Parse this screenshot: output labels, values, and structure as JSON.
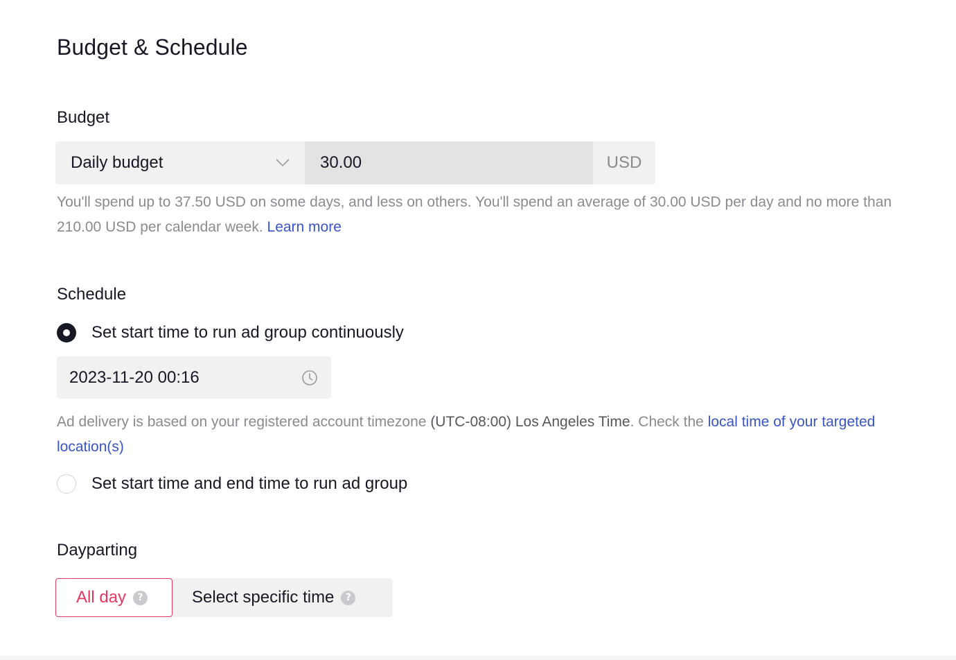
{
  "page": {
    "title": "Budget & Schedule"
  },
  "budget": {
    "section_title": "Budget",
    "type_selected": "Daily budget",
    "amount": "30.00",
    "currency": "USD",
    "help_text": "You'll spend up to 37.50 USD on some days, and less on others. You'll spend an average of 30.00 USD per day and no more than 210.00 USD per calendar week.",
    "learn_more": "Learn more"
  },
  "schedule": {
    "section_title": "Schedule",
    "option_continuous": "Set start time to run ad group continuously",
    "start_datetime": "2023-11-20 00:16",
    "timezone_prefix": "Ad delivery is based on your registered account timezone",
    "timezone_value": "(UTC-08:00) Los Angeles Time",
    "timezone_suffix": ". Check the",
    "local_time_link": "local time of your targeted location(s)",
    "option_start_end": "Set start time and end time to run ad group",
    "selected_option": "continuous"
  },
  "dayparting": {
    "section_title": "Dayparting",
    "option_all_day": "All day",
    "option_specific": "Select specific time",
    "selected": "All day"
  },
  "colors": {
    "accent": "#e3385f",
    "link": "#3955c4",
    "text": "#161823",
    "muted": "#8a8b91"
  },
  "icons": {
    "budget_type_dropdown": "chevron-down-icon",
    "date_picker": "clock-icon",
    "info": "question-circle-icon"
  }
}
